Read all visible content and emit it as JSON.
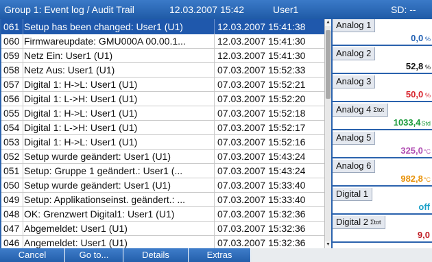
{
  "header": {
    "title": "Group 1: Event log / Audit Trail",
    "datetime": "12.03.2007 15:42",
    "user": "User1",
    "sd": "SD: --"
  },
  "log": {
    "rows": [
      {
        "id": "061",
        "message": "Setup has been changed: User1 (U1)",
        "timestamp": "12.03.2007 15:41:38",
        "selected": true
      },
      {
        "id": "060",
        "message": "Firmwareupdate: GMU000A 00.00.1...",
        "timestamp": "12.03.2007 15:41:30"
      },
      {
        "id": "059",
        "message": "Netz Ein: User1 (U1)",
        "timestamp": "12.03.2007 15:41:30"
      },
      {
        "id": "058",
        "message": "Netz Aus: User1 (U1)",
        "timestamp": "07.03.2007 15:52:33"
      },
      {
        "id": "057",
        "message": "Digital 1: H->L: User1 (U1)",
        "timestamp": "07.03.2007 15:52:21"
      },
      {
        "id": "056",
        "message": "Digital 1: L->H: User1 (U1)",
        "timestamp": "07.03.2007 15:52:20"
      },
      {
        "id": "055",
        "message": "Digital 1: H->L: User1 (U1)",
        "timestamp": "07.03.2007 15:52:18"
      },
      {
        "id": "054",
        "message": "Digital 1: L->H: User1 (U1)",
        "timestamp": "07.03.2007 15:52:17"
      },
      {
        "id": "053",
        "message": "Digital 1: H->L: User1 (U1)",
        "timestamp": "07.03.2007 15:52:16"
      },
      {
        "id": "052",
        "message": "Setup wurde geändert: User1 (U1)",
        "timestamp": "07.03.2007 15:43:24"
      },
      {
        "id": "051",
        "message": "Setup: Gruppe 1 geändert.: User1 (...",
        "timestamp": "07.03.2007 15:43:24"
      },
      {
        "id": "050",
        "message": "Setup wurde geändert: User1 (U1)",
        "timestamp": "07.03.2007 15:33:40"
      },
      {
        "id": "049",
        "message": "Setup: Applikationseinst. geändert.: ...",
        "timestamp": "07.03.2007 15:33:40"
      },
      {
        "id": "048",
        "message": "OK: Grenzwert Digital1: User1 (U1)",
        "timestamp": "07.03.2007 15:32:36"
      },
      {
        "id": "047",
        "message": "Abgemeldet: User1 (U1)",
        "timestamp": "07.03.2007 15:32:36"
      },
      {
        "id": "046",
        "message": "Angemeldet: User1 (U1)",
        "timestamp": "07.03.2007 15:32:36"
      }
    ]
  },
  "scrollbar": {
    "up_icon": "▲",
    "down_icon": "▼"
  },
  "channels": [
    {
      "name": "Analog 1",
      "value": "0,0",
      "unit": " %",
      "color": "#1f5fb3"
    },
    {
      "name": "Analog 2",
      "value": "52,8",
      "unit": " %",
      "color": "#111111"
    },
    {
      "name": "Analog 3",
      "value": "50,0",
      "unit": " %",
      "color": "#d8252e"
    },
    {
      "name": "Analog 4",
      "sigma": "Σtot",
      "value": "1033,4",
      "unit": "Std",
      "color": "#1a9a3a"
    },
    {
      "name": "Analog 5",
      "value": "325,0",
      "unit": "°C",
      "color": "#b14fb3"
    },
    {
      "name": "Analog 6",
      "value": "982,8",
      "unit": "°C",
      "color": "#e8930c"
    },
    {
      "name": "Digital 1",
      "value": "off",
      "unit": "",
      "color": "#1aa0c8"
    },
    {
      "name": "Digital 2",
      "sigma": "Σtot",
      "value": "9,0",
      "unit": "",
      "color": "#c01a22"
    }
  ],
  "buttons": {
    "cancel": "Cancel",
    "goto": "Go to...",
    "details": "Details",
    "extras": "Extras"
  }
}
